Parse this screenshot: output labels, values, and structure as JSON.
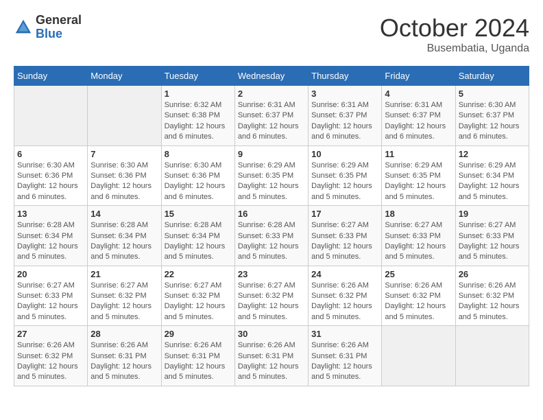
{
  "logo": {
    "general": "General",
    "blue": "Blue"
  },
  "title": "October 2024",
  "subtitle": "Busembatia, Uganda",
  "days_of_week": [
    "Sunday",
    "Monday",
    "Tuesday",
    "Wednesday",
    "Thursday",
    "Friday",
    "Saturday"
  ],
  "weeks": [
    [
      {
        "day": "",
        "info": ""
      },
      {
        "day": "",
        "info": ""
      },
      {
        "day": "1",
        "info": "Sunrise: 6:32 AM\nSunset: 6:38 PM\nDaylight: 12 hours and 6 minutes."
      },
      {
        "day": "2",
        "info": "Sunrise: 6:31 AM\nSunset: 6:37 PM\nDaylight: 12 hours and 6 minutes."
      },
      {
        "day": "3",
        "info": "Sunrise: 6:31 AM\nSunset: 6:37 PM\nDaylight: 12 hours and 6 minutes."
      },
      {
        "day": "4",
        "info": "Sunrise: 6:31 AM\nSunset: 6:37 PM\nDaylight: 12 hours and 6 minutes."
      },
      {
        "day": "5",
        "info": "Sunrise: 6:30 AM\nSunset: 6:37 PM\nDaylight: 12 hours and 6 minutes."
      }
    ],
    [
      {
        "day": "6",
        "info": "Sunrise: 6:30 AM\nSunset: 6:36 PM\nDaylight: 12 hours and 6 minutes."
      },
      {
        "day": "7",
        "info": "Sunrise: 6:30 AM\nSunset: 6:36 PM\nDaylight: 12 hours and 6 minutes."
      },
      {
        "day": "8",
        "info": "Sunrise: 6:30 AM\nSunset: 6:36 PM\nDaylight: 12 hours and 6 minutes."
      },
      {
        "day": "9",
        "info": "Sunrise: 6:29 AM\nSunset: 6:35 PM\nDaylight: 12 hours and 5 minutes."
      },
      {
        "day": "10",
        "info": "Sunrise: 6:29 AM\nSunset: 6:35 PM\nDaylight: 12 hours and 5 minutes."
      },
      {
        "day": "11",
        "info": "Sunrise: 6:29 AM\nSunset: 6:35 PM\nDaylight: 12 hours and 5 minutes."
      },
      {
        "day": "12",
        "info": "Sunrise: 6:29 AM\nSunset: 6:34 PM\nDaylight: 12 hours and 5 minutes."
      }
    ],
    [
      {
        "day": "13",
        "info": "Sunrise: 6:28 AM\nSunset: 6:34 PM\nDaylight: 12 hours and 5 minutes."
      },
      {
        "day": "14",
        "info": "Sunrise: 6:28 AM\nSunset: 6:34 PM\nDaylight: 12 hours and 5 minutes."
      },
      {
        "day": "15",
        "info": "Sunrise: 6:28 AM\nSunset: 6:34 PM\nDaylight: 12 hours and 5 minutes."
      },
      {
        "day": "16",
        "info": "Sunrise: 6:28 AM\nSunset: 6:33 PM\nDaylight: 12 hours and 5 minutes."
      },
      {
        "day": "17",
        "info": "Sunrise: 6:27 AM\nSunset: 6:33 PM\nDaylight: 12 hours and 5 minutes."
      },
      {
        "day": "18",
        "info": "Sunrise: 6:27 AM\nSunset: 6:33 PM\nDaylight: 12 hours and 5 minutes."
      },
      {
        "day": "19",
        "info": "Sunrise: 6:27 AM\nSunset: 6:33 PM\nDaylight: 12 hours and 5 minutes."
      }
    ],
    [
      {
        "day": "20",
        "info": "Sunrise: 6:27 AM\nSunset: 6:33 PM\nDaylight: 12 hours and 5 minutes."
      },
      {
        "day": "21",
        "info": "Sunrise: 6:27 AM\nSunset: 6:32 PM\nDaylight: 12 hours and 5 minutes."
      },
      {
        "day": "22",
        "info": "Sunrise: 6:27 AM\nSunset: 6:32 PM\nDaylight: 12 hours and 5 minutes."
      },
      {
        "day": "23",
        "info": "Sunrise: 6:27 AM\nSunset: 6:32 PM\nDaylight: 12 hours and 5 minutes."
      },
      {
        "day": "24",
        "info": "Sunrise: 6:26 AM\nSunset: 6:32 PM\nDaylight: 12 hours and 5 minutes."
      },
      {
        "day": "25",
        "info": "Sunrise: 6:26 AM\nSunset: 6:32 PM\nDaylight: 12 hours and 5 minutes."
      },
      {
        "day": "26",
        "info": "Sunrise: 6:26 AM\nSunset: 6:32 PM\nDaylight: 12 hours and 5 minutes."
      }
    ],
    [
      {
        "day": "27",
        "info": "Sunrise: 6:26 AM\nSunset: 6:32 PM\nDaylight: 12 hours and 5 minutes."
      },
      {
        "day": "28",
        "info": "Sunrise: 6:26 AM\nSunset: 6:31 PM\nDaylight: 12 hours and 5 minutes."
      },
      {
        "day": "29",
        "info": "Sunrise: 6:26 AM\nSunset: 6:31 PM\nDaylight: 12 hours and 5 minutes."
      },
      {
        "day": "30",
        "info": "Sunrise: 6:26 AM\nSunset: 6:31 PM\nDaylight: 12 hours and 5 minutes."
      },
      {
        "day": "31",
        "info": "Sunrise: 6:26 AM\nSunset: 6:31 PM\nDaylight: 12 hours and 5 minutes."
      },
      {
        "day": "",
        "info": ""
      },
      {
        "day": "",
        "info": ""
      }
    ]
  ]
}
